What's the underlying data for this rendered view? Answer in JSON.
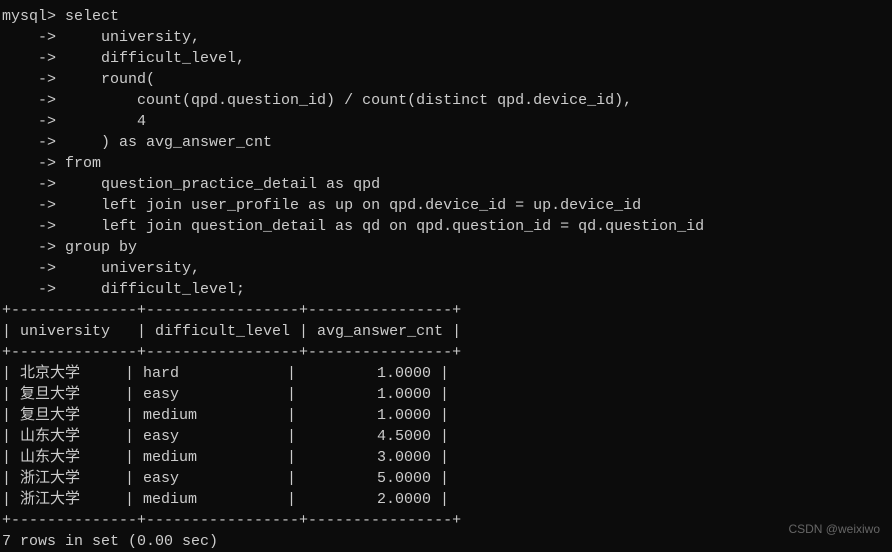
{
  "prompt": "mysql>",
  "cont": "    ->",
  "sql": {
    "l0": " select",
    "l1": "     university,",
    "l2": "     difficult_level,",
    "l3": "     round(",
    "l4": "         count(qpd.question_id) / count(distinct qpd.device_id),",
    "l5": "         4",
    "l6": "     ) as avg_answer_cnt",
    "l7": " from",
    "l8": "     question_practice_detail as qpd",
    "l9": "     left join user_profile as up on qpd.device_id = up.device_id",
    "l10": "     left join question_detail as qd on qpd.question_id = qd.question_id",
    "l11": " group by",
    "l12": "     university,",
    "l13": "     difficult_level;"
  },
  "table": {
    "sep": "+--------------+-----------------+----------------+",
    "header": "| university   | difficult_level | avg_answer_cnt |",
    "rows": [
      "| 北京大学     | hard            |         1.0000 |",
      "| 复旦大学     | easy            |         1.0000 |",
      "| 复旦大学     | medium          |         1.0000 |",
      "| 山东大学     | easy            |         4.5000 |",
      "| 山东大学     | medium          |         3.0000 |",
      "| 浙江大学     | easy            |         5.0000 |",
      "| 浙江大学     | medium          |         2.0000 |"
    ]
  },
  "chart_data": {
    "type": "table",
    "columns": [
      "university",
      "difficult_level",
      "avg_answer_cnt"
    ],
    "rows": [
      {
        "university": "北京大学",
        "difficult_level": "hard",
        "avg_answer_cnt": 1.0
      },
      {
        "university": "复旦大学",
        "difficult_level": "easy",
        "avg_answer_cnt": 1.0
      },
      {
        "university": "复旦大学",
        "difficult_level": "medium",
        "avg_answer_cnt": 1.0
      },
      {
        "university": "山东大学",
        "difficult_level": "easy",
        "avg_answer_cnt": 4.5
      },
      {
        "university": "山东大学",
        "difficult_level": "medium",
        "avg_answer_cnt": 3.0
      },
      {
        "university": "浙江大学",
        "difficult_level": "easy",
        "avg_answer_cnt": 5.0
      },
      {
        "university": "浙江大学",
        "difficult_level": "medium",
        "avg_answer_cnt": 2.0
      }
    ]
  },
  "footer": "7 rows in set (0.00 sec)",
  "watermark": "CSDN @weixiwo"
}
